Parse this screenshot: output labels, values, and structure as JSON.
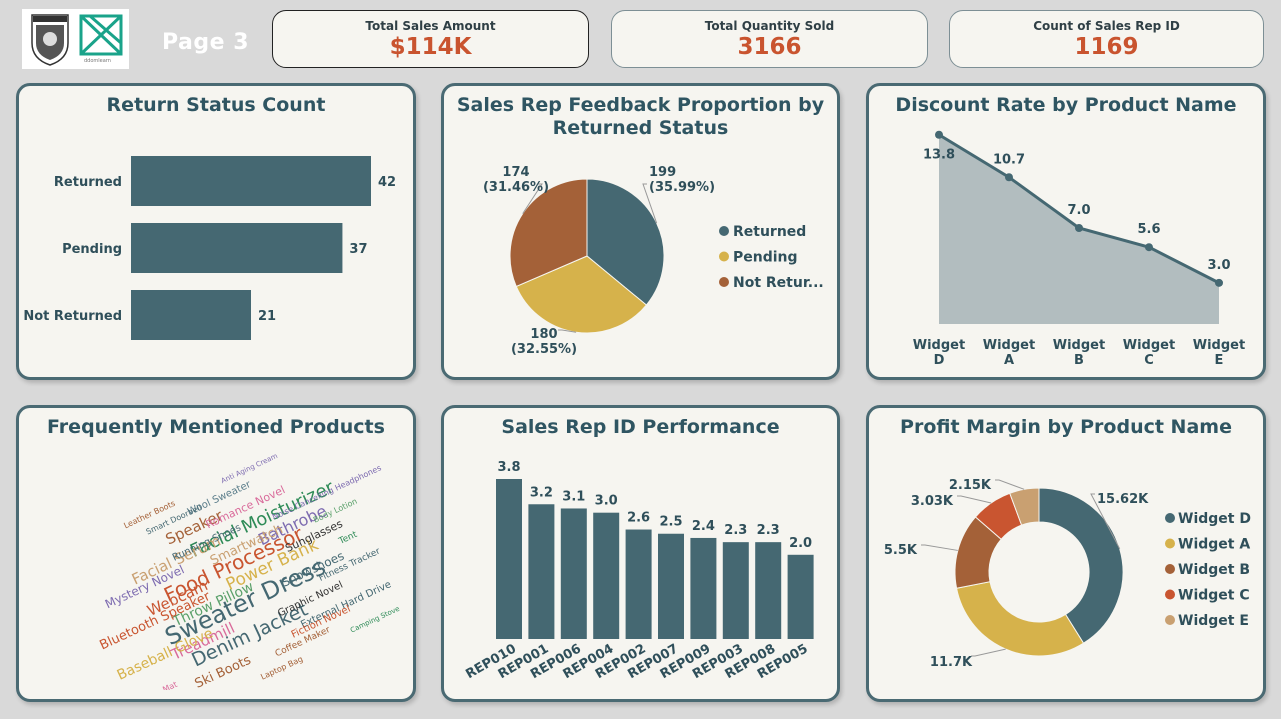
{
  "header": {
    "page_title": "Page 3",
    "logo_caption": "ddomlearn"
  },
  "kpis": [
    {
      "label": "Total Sales Amount",
      "value": "$114K"
    },
    {
      "label": "Total Quantity Sold",
      "value": "3166"
    },
    {
      "label": "Count of Sales Rep ID",
      "value": "1169"
    }
  ],
  "colors": {
    "teal": "#456872",
    "mustard": "#d6b24b",
    "brown": "#a46138",
    "red": "#c95530",
    "tan": "#c9a071",
    "value_red": "#c9542f",
    "area_fill": "#b2bdbf"
  },
  "chart_data": [
    {
      "id": "return_status",
      "type": "bar",
      "orientation": "horizontal",
      "title": "Return Status Count",
      "categories": [
        "Returned",
        "Pending",
        "Not Returned"
      ],
      "values": [
        42,
        37,
        21
      ],
      "data_labels": [
        "42",
        "37",
        "21"
      ]
    },
    {
      "id": "feedback_pie",
      "type": "pie",
      "title": "Sales Rep Feedback Proportion by Returned Status",
      "title_lines": [
        "Sales Rep Feedback Proportion by",
        "Returned Status"
      ],
      "categories": [
        "Returned",
        "Pending",
        "Not Returned"
      ],
      "legend_labels": [
        "Returned",
        "Pending",
        "Not Retur..."
      ],
      "values": [
        199,
        180,
        174
      ],
      "value_labels": [
        "199",
        "180",
        "174"
      ],
      "percent_labels": [
        "(35.99%)",
        "(32.55%)",
        "(31.46%)"
      ],
      "legend": "right"
    },
    {
      "id": "discount_rate",
      "type": "area",
      "title": "Discount Rate by Product Name",
      "categories": [
        "Widget D",
        "Widget A",
        "Widget B",
        "Widget C",
        "Widget E"
      ],
      "category_lines": [
        [
          "Widget",
          "D"
        ],
        [
          "Widget",
          "A"
        ],
        [
          "Widget",
          "B"
        ],
        [
          "Widget",
          "C"
        ],
        [
          "Widget",
          "E"
        ]
      ],
      "values": [
        13.8,
        10.7,
        7.0,
        5.6,
        3.0
      ],
      "data_labels": [
        "13.8",
        "10.7",
        "7.0",
        "5.6",
        "3.0"
      ]
    },
    {
      "id": "word_cloud",
      "type": "wordcloud",
      "title": "Frequently Mentioned Products",
      "words": [
        {
          "text": "Sweater Dress",
          "color": "#456872"
        },
        {
          "text": "Food Processor",
          "color": "#c95530"
        },
        {
          "text": "Facial Moisturizer",
          "color": "#2e8b57"
        },
        {
          "text": "Denim Jacket",
          "color": "#456872"
        },
        {
          "text": "Power Bank",
          "color": "#d6b24b"
        },
        {
          "text": "Facial Serum",
          "color": "#c9a071"
        },
        {
          "text": "Bathrobe",
          "color": "#7d6bb0"
        },
        {
          "text": "Webcam",
          "color": "#c95530"
        },
        {
          "text": "Speaker",
          "color": "#a46138"
        },
        {
          "text": "Treadmill",
          "color": "#d96a9a"
        },
        {
          "text": "Snowshoes",
          "color": "#456872"
        },
        {
          "text": "Smartwatch",
          "color": "#c9a071"
        },
        {
          "text": "Baseball Glove",
          "color": "#d6b24b"
        },
        {
          "text": "Throw Pillow",
          "color": "#5aa06a"
        },
        {
          "text": "Ski Boots",
          "color": "#a46138"
        },
        {
          "text": "Bluetooth Speaker",
          "color": "#c95530"
        },
        {
          "text": "Mystery Novel",
          "color": "#7d6bb0"
        },
        {
          "text": "Sunglasses",
          "color": "#333333"
        },
        {
          "text": "Running Shoes",
          "color": "#456872"
        },
        {
          "text": "Graphic Novel",
          "color": "#333333"
        },
        {
          "text": "Coffee Maker",
          "color": "#a46138"
        },
        {
          "text": "External Hard Drive",
          "color": "#456872"
        },
        {
          "text": "Wool Sweater",
          "color": "#5a7d8a"
        },
        {
          "text": "Tent",
          "color": "#2e8b57"
        },
        {
          "text": "Romance Novel",
          "color": "#d96a9a"
        },
        {
          "text": "Fiction Novel",
          "color": "#c95530"
        },
        {
          "text": "Noise Cancelling Headphones",
          "color": "#7d6bb0"
        },
        {
          "text": "Body Lotion",
          "color": "#5aa06a"
        },
        {
          "text": "Fitness Tracker",
          "color": "#456872"
        },
        {
          "text": "Laptop Bag",
          "color": "#a46138"
        },
        {
          "text": "Air Purifier",
          "color": "#c9a071"
        },
        {
          "text": "Camping Stove",
          "color": "#2e8b57"
        },
        {
          "text": "Yoga Mat",
          "color": "#d96a9a"
        },
        {
          "text": "Smart Doorbell",
          "color": "#456872"
        },
        {
          "text": "Leather Boots",
          "color": "#a46138"
        },
        {
          "text": "Anti Aging Cream",
          "color": "#7d6bb0"
        }
      ]
    },
    {
      "id": "sales_rep_perf",
      "type": "bar",
      "orientation": "vertical",
      "title": "Sales Rep ID Performance",
      "categories": [
        "REP010",
        "REP001",
        "REP006",
        "REP004",
        "REP002",
        "REP007",
        "REP009",
        "REP003",
        "REP008",
        "REP005"
      ],
      "values": [
        3.8,
        3.2,
        3.1,
        3.0,
        2.6,
        2.5,
        2.4,
        2.3,
        2.3,
        2.0
      ],
      "data_labels": [
        "3.8",
        "3.2",
        "3.1",
        "3.0",
        "2.6",
        "2.5",
        "2.4",
        "2.3",
        "2.3",
        "2.0"
      ]
    },
    {
      "id": "profit_margin",
      "type": "pie",
      "variant": "donut",
      "title": "Profit Margin by Product Name",
      "categories": [
        "Widget D",
        "Widget A",
        "Widget B",
        "Widget C",
        "Widget E"
      ],
      "values": [
        15.62,
        11.7,
        5.5,
        3.03,
        2.15
      ],
      "value_labels": [
        "15.62K",
        "11.7K",
        "5.5K",
        "3.03K",
        "2.15K"
      ],
      "legend": "right"
    }
  ]
}
